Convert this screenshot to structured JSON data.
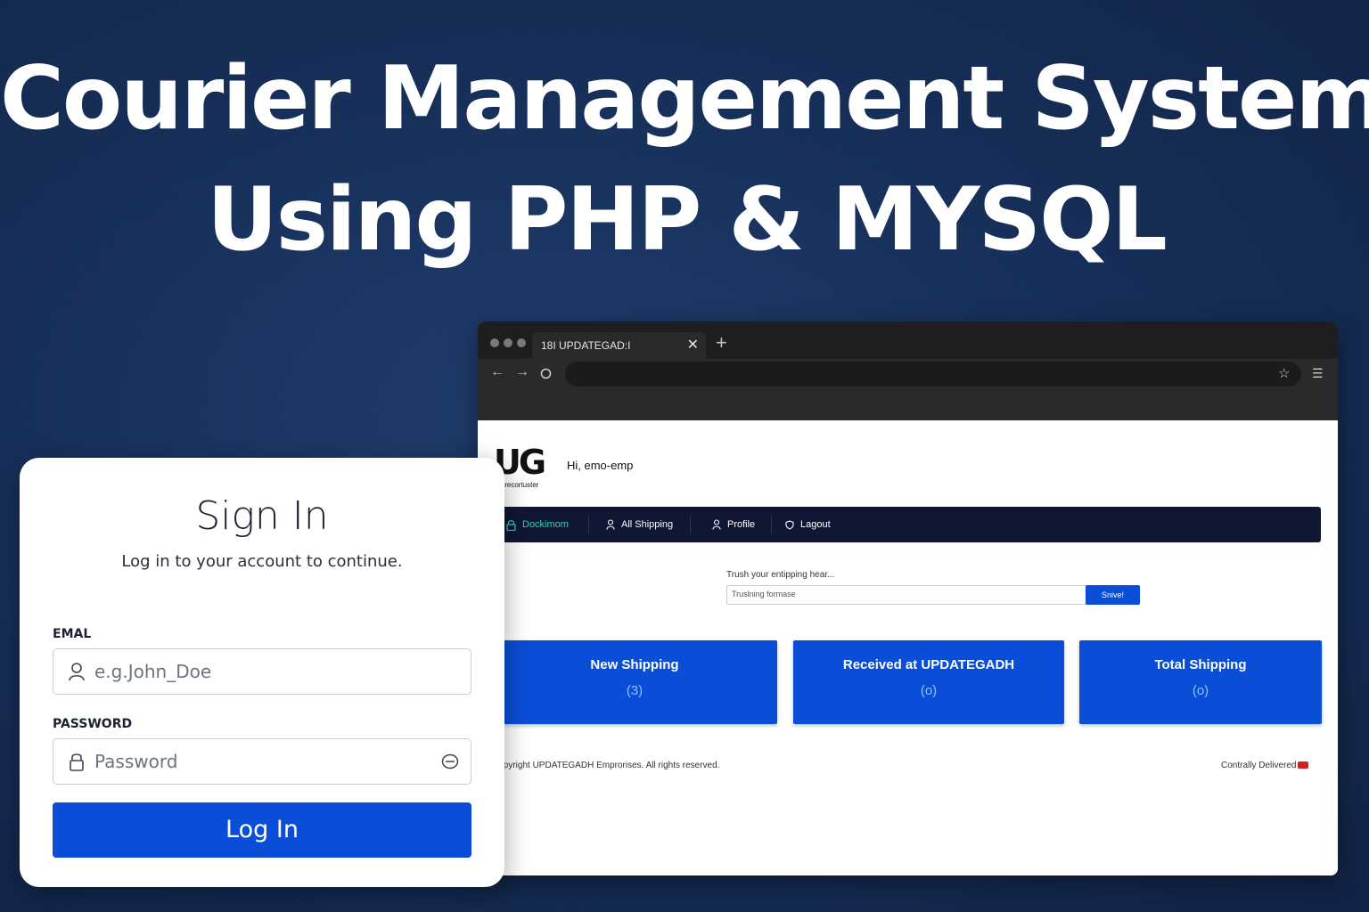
{
  "headline": {
    "line1": "Courier Management System",
    "line2": "Using PHP & MYSQL"
  },
  "signin": {
    "title": "Sign In",
    "subtitle": "Log in to your account to continue.",
    "email_label": "EMAL",
    "email_placeholder": "e.g.John_Doe",
    "password_label": "PASSWORD",
    "password_placeholder": "Password",
    "login_button": "Log In"
  },
  "browser": {
    "tab_title": "18I  UPDATEGAD:I",
    "tab_close": "✕",
    "new_tab": "+",
    "icons": [
      "back-icon",
      "forward-icon",
      "reload-icon",
      "star-icon",
      "menu-icon"
    ]
  },
  "app": {
    "logo_text": "UG",
    "logo_subtext": "trecortuster",
    "greeting": "Hi, emo-emp",
    "nav": [
      {
        "label": "Dockimom",
        "icon": "lock-icon",
        "active": true
      },
      {
        "label": "All Shipping",
        "icon": "user-icon",
        "active": false
      },
      {
        "label": "Profile",
        "icon": "user-icon",
        "active": false
      },
      {
        "label": "Lagout",
        "icon": "shield-icon",
        "active": false
      }
    ],
    "search": {
      "label": "Trush your entipping hear...",
      "value": "Truslning formase",
      "button": "Snive!"
    },
    "cards": [
      {
        "title": "New Shipping",
        "value": "(3)"
      },
      {
        "title": "Received at UPDATEGADH",
        "value": "(o)"
      },
      {
        "title": "Total Shipping",
        "value": "(o)"
      }
    ],
    "footer_left": "Copyright UPDATEGADH Emprorises. All rights reserved.",
    "footer_right": "Contrally Delivered"
  },
  "colors": {
    "background": "#17305a",
    "accent_blue": "#0a4ed8",
    "nav_dark": "#0f1733",
    "nav_active": "#2dd4bf"
  }
}
